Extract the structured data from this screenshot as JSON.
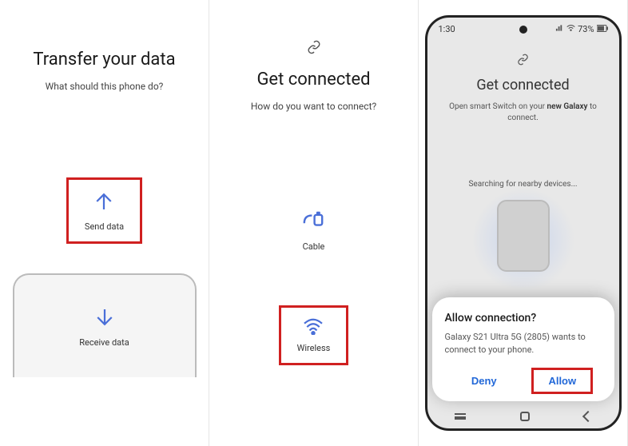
{
  "panel1": {
    "title": "Transfer your data",
    "subtitle": "What should this phone do?",
    "send_label": "Send data",
    "receive_label": "Receive data"
  },
  "panel2": {
    "title": "Get connected",
    "subtitle": "How do you want to connect?",
    "cable_label": "Cable",
    "wireless_label": "Wireless"
  },
  "panel3": {
    "status": {
      "time": "1:30",
      "battery": "73%"
    },
    "title": "Get connected",
    "instruction_pre": "Open smart Switch on your ",
    "instruction_bold": "new Galaxy",
    "instruction_post": " to connect.",
    "searching": "Searching for nearby devices...",
    "sheet": {
      "title": "Allow connection?",
      "body": "Galaxy S21 Ultra 5G (2805) wants to connect to your phone.",
      "deny": "Deny",
      "allow": "Allow"
    }
  }
}
